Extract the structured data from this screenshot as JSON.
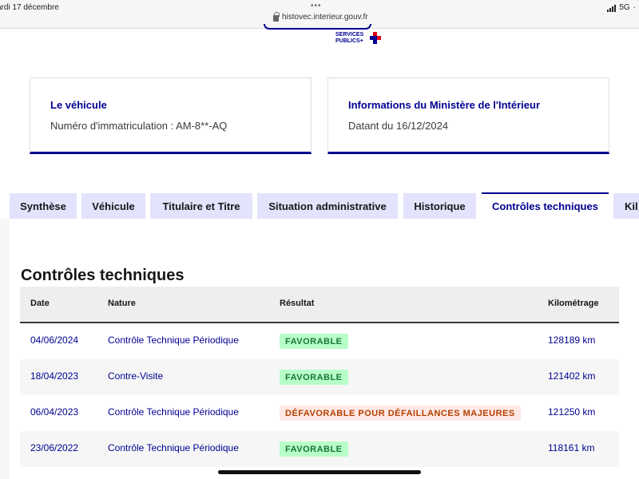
{
  "statusbar": {
    "time": "ardi 17 décembre",
    "dots": "•••",
    "url": "histovec.interieur.gouv.fr",
    "network": "5G",
    "battery_fragment": "·"
  },
  "header": {
    "logo_line1": "SERVICES",
    "logo_line2": "PUBLICS+"
  },
  "cards": {
    "vehicle": {
      "title": "Le véhicule",
      "text": "Numéro d'immatriculation : AM-8**-AQ"
    },
    "ministry": {
      "title": "Informations du Ministère de l'Intérieur",
      "text": "Datant du 16/12/2024"
    }
  },
  "tabs": [
    {
      "label": "Synthèse"
    },
    {
      "label": "Véhicule"
    },
    {
      "label": "Titulaire et Titre"
    },
    {
      "label": "Situation administrative"
    },
    {
      "label": "Historique"
    },
    {
      "label": "Contrôles techniques"
    },
    {
      "label": "Kil"
    }
  ],
  "active_tab": "Contrôles techniques",
  "section": {
    "title": "Contrôles techniques"
  },
  "table": {
    "headers": {
      "date": "Date",
      "nature": "Nature",
      "result": "Résultat",
      "km": "Kilométrage"
    },
    "rows": [
      {
        "date": "04/06/2024",
        "nature": "Contrôle Technique Périodique",
        "result": "FAVORABLE",
        "km": "128189 km"
      },
      {
        "date": "18/04/2023",
        "nature": "Contre-Visite",
        "result": "FAVORABLE",
        "km": "121402 km"
      },
      {
        "date": "06/04/2023",
        "nature": "Contrôle Technique Périodique",
        "result": "DÉFAVORABLE POUR DÉFAILLANCES MAJEURES",
        "km": "121250 km"
      },
      {
        "date": "23/06/2022",
        "nature": "Contrôle Technique Périodique",
        "result": "FAVORABLE",
        "km": "118161 km"
      }
    ]
  },
  "colors": {
    "brand_blue": "#000091",
    "favorable_bg": "#b8fec9",
    "favorable_text": "#18753c",
    "defavorable_bg": "#ffe9e6",
    "defavorable_text": "#b34000",
    "tab_bg": "#e3e3fd"
  }
}
